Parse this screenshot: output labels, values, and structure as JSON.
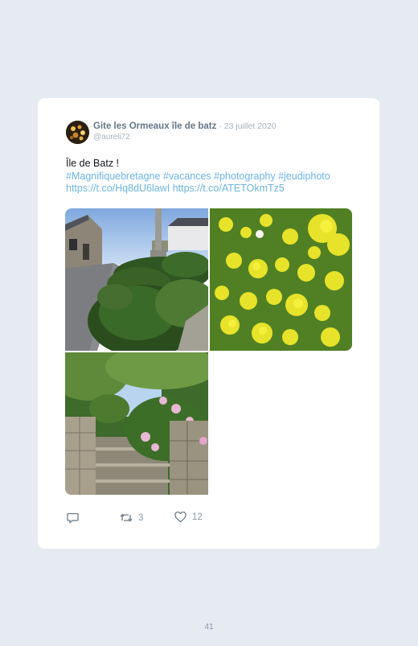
{
  "tweet": {
    "author_name": "Gite les Ormeaux île de batz",
    "separator": " · ",
    "date": "23 juillet 2020",
    "handle": "@aureli72",
    "text_line1": "Île de Batz !",
    "hashtags": "#Magnifiquebretagne #vacances #photography #jeudiphoto",
    "links": "https://t.co/Hq8dU6lawI https://t.co/ATETOkmTz5",
    "photos": [
      {
        "name": "stone-houses-garden-path"
      },
      {
        "name": "yellow-rapeseed-flowers"
      },
      {
        "name": "hydrangea-stone-steps"
      }
    ]
  },
  "actions": {
    "reply_icon": "reply-icon",
    "retweet_icon": "retweet-icon",
    "retweet_count": "3",
    "like_icon": "heart-icon",
    "like_count": "12"
  },
  "page_number": "41",
  "colors": {
    "background": "#e6ebf2",
    "card": "#ffffff",
    "link": "#6cb4e4",
    "muted": "#8899a6"
  }
}
